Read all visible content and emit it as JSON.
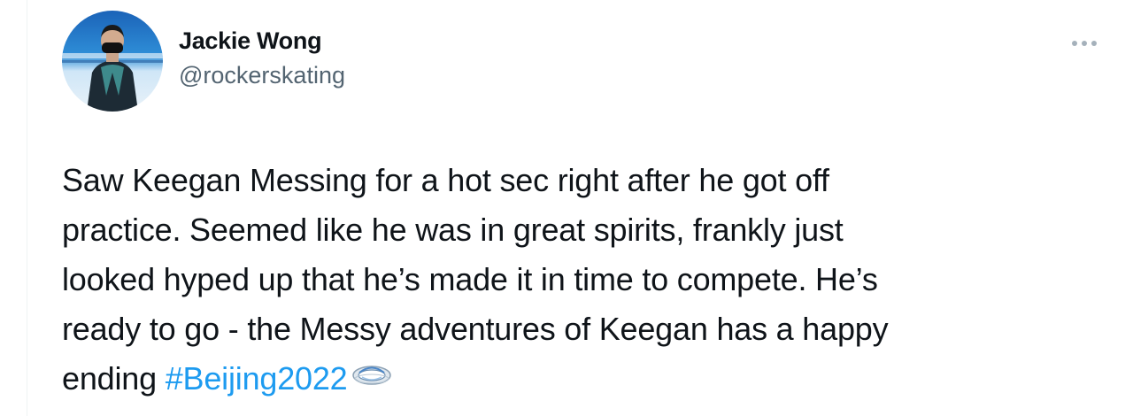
{
  "tweet": {
    "author": {
      "display_name": "Jackie Wong",
      "handle": "@rockerskating",
      "avatar_icon": "profile-photo"
    },
    "more_icon": "more-horizontal-icon",
    "text_lines": [
      "Saw Keegan Messing for a hot sec right after he got off",
      "practice. Seemed like he was in great spirits, frankly just",
      "looked hyped up that he’s made it in time to compete. He’s",
      "ready to go - the Messy adventures of Keegan has a happy",
      "ending"
    ],
    "hashtag": "#Beijing2022",
    "hashflag_icon": "beijing-2022-hashflag-icon"
  },
  "colors": {
    "text": "#0f1419",
    "secondary": "#536471",
    "link": "#1d9bf0",
    "divider": "#eff3f4"
  }
}
